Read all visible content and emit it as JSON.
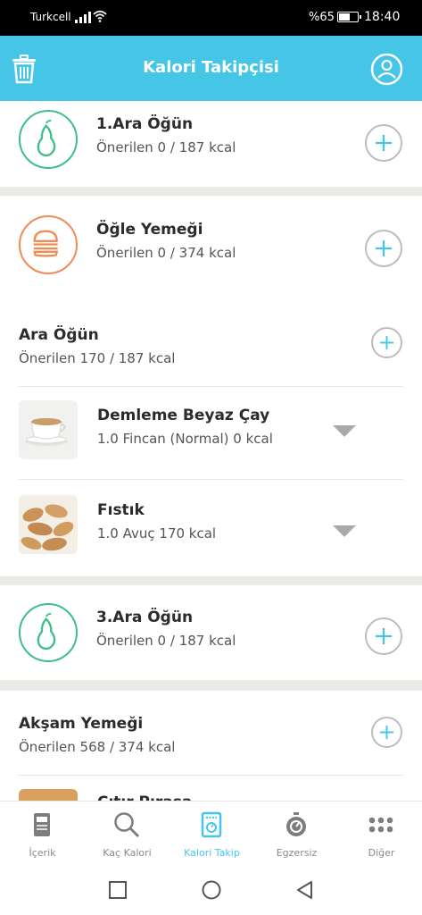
{
  "status_bar": {
    "carrier": "Turkcell",
    "battery_text": "%65",
    "battery_level": 0.65,
    "time": "18:40"
  },
  "header": {
    "title": "Kalori Takipçisi"
  },
  "meals": {
    "ara_ogun_1": {
      "title": "1.Ara Öğün",
      "subtitle": "Önerilen 0 / 187 kcal"
    },
    "ogle": {
      "title": "Öğle Yemeği",
      "subtitle": "Önerilen 0 / 374 kcal"
    },
    "ara_ogun": {
      "title": "Ara Öğün",
      "subtitle": "Önerilen 170 / 187 kcal",
      "foods": [
        {
          "name": "Demleme Beyaz Çay",
          "detail": "1.0 Fincan (Normal) 0 kcal"
        },
        {
          "name": "Fıstık",
          "detail": "1.0 Avuç 170 kcal"
        }
      ]
    },
    "ara_ogun_3": {
      "title": "3.Ara Öğün",
      "subtitle": "Önerilen 0 / 187 kcal"
    },
    "aksam": {
      "title": "Akşam Yemeği",
      "subtitle": "Önerilen 568 / 374 kcal",
      "foods": [
        {
          "name": "Çıtır Pırasa"
        }
      ]
    }
  },
  "colors": {
    "accent": "#45c6e7",
    "snack_green": "#3dbf8a",
    "lunch_orange": "#ef8c55"
  },
  "bottom_nav": {
    "items": [
      {
        "label": "İçerik",
        "icon": "document-icon"
      },
      {
        "label": "Kaç Kalori",
        "icon": "search-icon"
      },
      {
        "label": "Kalori Takip",
        "icon": "scale-icon"
      },
      {
        "label": "Egzersiz",
        "icon": "stopwatch-icon"
      },
      {
        "label": "Diğer",
        "icon": "more-grid-icon"
      }
    ],
    "active": "Kalori Takip"
  }
}
